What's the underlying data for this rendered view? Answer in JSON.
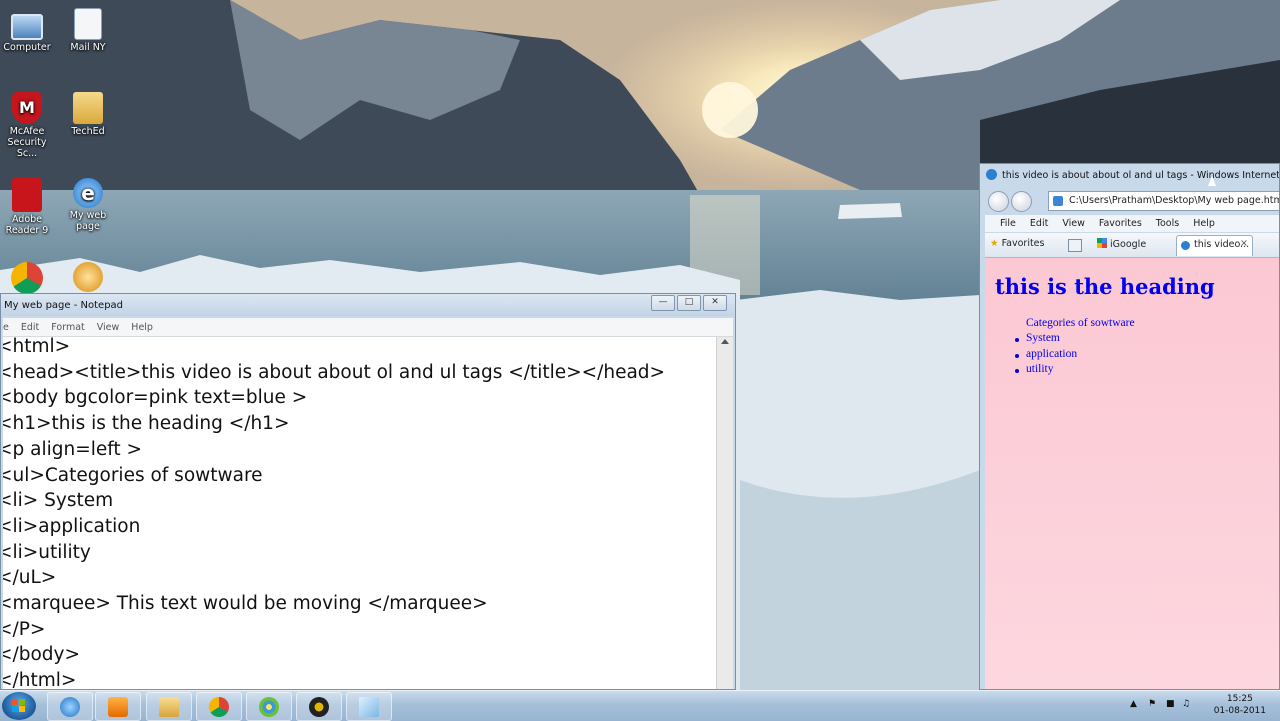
{
  "desktop": {
    "icons": [
      {
        "label": "Computer",
        "icon": "computer-icon"
      },
      {
        "label": "Mail NY",
        "icon": "document-icon"
      },
      {
        "label": "McAfee Security Sc...",
        "icon": "mcafee-shield-icon"
      },
      {
        "label": "TechEd",
        "icon": "folder-icon"
      },
      {
        "label": "Adobe Reader 9",
        "icon": "adobe-reader-icon"
      },
      {
        "label": "My web page",
        "icon": "internet-explorer-icon"
      },
      {
        "label": "",
        "icon": "chrome-icon"
      },
      {
        "label": "",
        "icon": "media-player-icon"
      }
    ]
  },
  "notepad": {
    "title": "My web page - Notepad",
    "menu": [
      "e",
      "Edit",
      "Format",
      "View",
      "Help"
    ],
    "lines": [
      "<html>",
      "<head><title>this video is about about ol and ul tags </title></head>",
      "<body bgcolor=pink text=blue >",
      "<h1>this is the heading </h1>",
      "<p align=left >",
      "<ul>Categories of sowtware",
      "<li> System",
      "<li>application",
      "<li>utility",
      "</uL>",
      "<marquee> This text would be moving </marquee>",
      "</P>",
      "</body>",
      "</html>"
    ]
  },
  "ie": {
    "title": "this video is about about ol and ul tags - Windows Internet Explo",
    "address": "C:\\Users\\Pratham\\Desktop\\My web page.html",
    "menu": [
      "File",
      "Edit",
      "View",
      "Favorites",
      "Tools",
      "Help"
    ],
    "favorites_label": "Favorites",
    "igoogle_label": "iGoogle",
    "tab_label": "this video...",
    "page": {
      "heading": "this is the heading",
      "category": "Categories of sowtware",
      "items": [
        "System",
        "application",
        "utility"
      ],
      "background": "#fbc8d3",
      "text_color": "#0000ee"
    }
  },
  "taskbar": {
    "apps": [
      "internet-explorer",
      "media-player",
      "file-explorer",
      "chrome",
      "paint",
      "winamp",
      "notepad"
    ],
    "clock_time": "15:25",
    "clock_date": "01-08-2011"
  }
}
